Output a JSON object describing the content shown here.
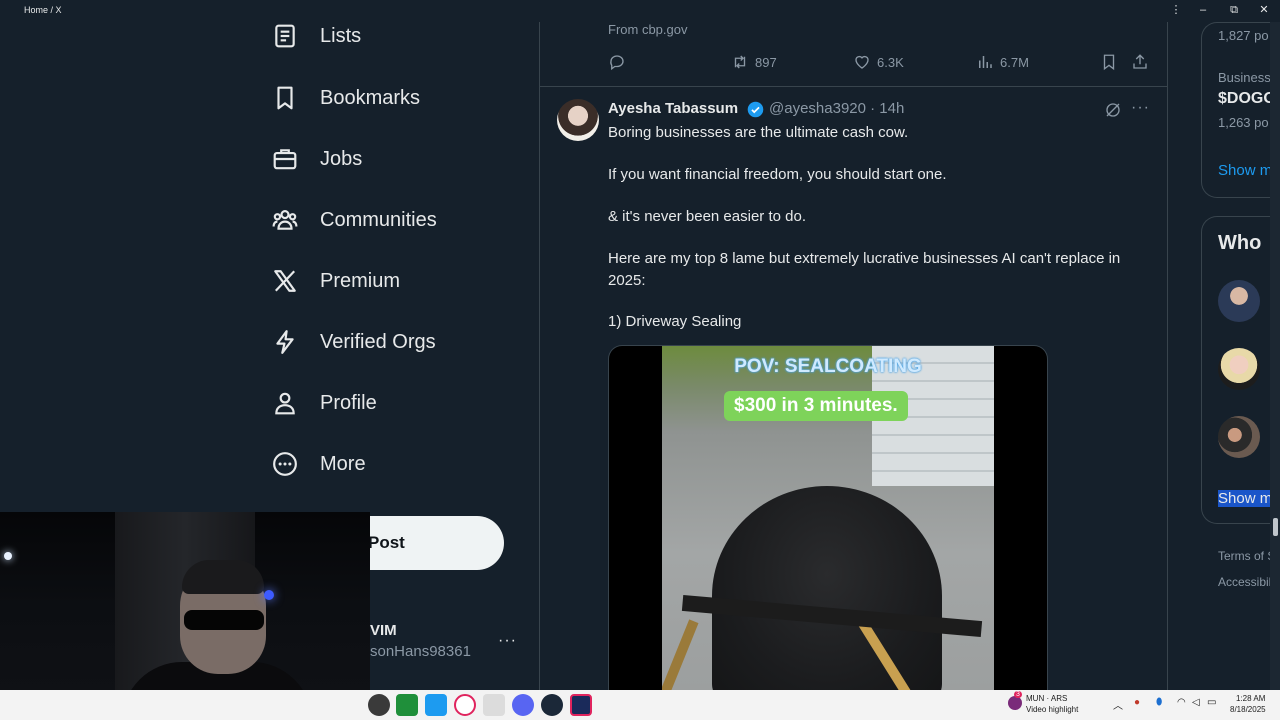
{
  "window": {
    "title": "Home / X",
    "controls": [
      "⋮",
      "–",
      "⧉",
      "✕"
    ]
  },
  "nav": {
    "items": [
      {
        "label": "Lists",
        "icon": "lists-icon"
      },
      {
        "label": "Bookmarks",
        "icon": "bookmark-icon"
      },
      {
        "label": "Jobs",
        "icon": "briefcase-icon"
      },
      {
        "label": "Communities",
        "icon": "communities-icon"
      },
      {
        "label": "Premium",
        "icon": "x-logo-icon"
      },
      {
        "label": "Verified Orgs",
        "icon": "lightning-icon"
      },
      {
        "label": "Profile",
        "icon": "person-icon"
      },
      {
        "label": "More",
        "icon": "more-circle-icon"
      }
    ],
    "post_label": "Post",
    "account_name": "VIM",
    "account_handle": "sonHans98361",
    "account_more": "···"
  },
  "previous_tweet": {
    "source": "From cbp.gov",
    "retweets": "897",
    "likes": "6.3K",
    "views": "6.7M"
  },
  "tweet": {
    "author": "Ayesha Tabassum",
    "handle": "@ayesha3920 · 14h",
    "more": "···",
    "lines": [
      "Boring businesses are the ultimate cash cow.",
      "If you want financial freedom, you should start one.",
      "& it's never been easier to do.",
      "Here are my top 8 lame but extremely lucrative businesses AI can't replace in 2025:",
      "1) Driveway Sealing"
    ],
    "media_caption_1": "POV: SEALCOATING",
    "media_caption_2": "$300 in 3 minutes."
  },
  "right_sidebar": {
    "trend1_count": "1,827 po",
    "trend2_category": "Business",
    "trend2_name": "$DOGO",
    "trend2_count": "1,263 po",
    "show_more_1": "Show m",
    "who_to_follow": "Who",
    "show_more_2": "Show m",
    "terms": "Terms of S",
    "accessibility": "Accessibil"
  },
  "taskbar": {
    "media_title": "MUN · ARS",
    "media_sub": "Video highlight",
    "time": "1:28 AM",
    "date": "8/18/2025",
    "badge": "3"
  },
  "colors": {
    "background": "#15202b",
    "accent": "#1d9bf0",
    "muted": "#8b98a5",
    "text": "#e7e9ea"
  }
}
